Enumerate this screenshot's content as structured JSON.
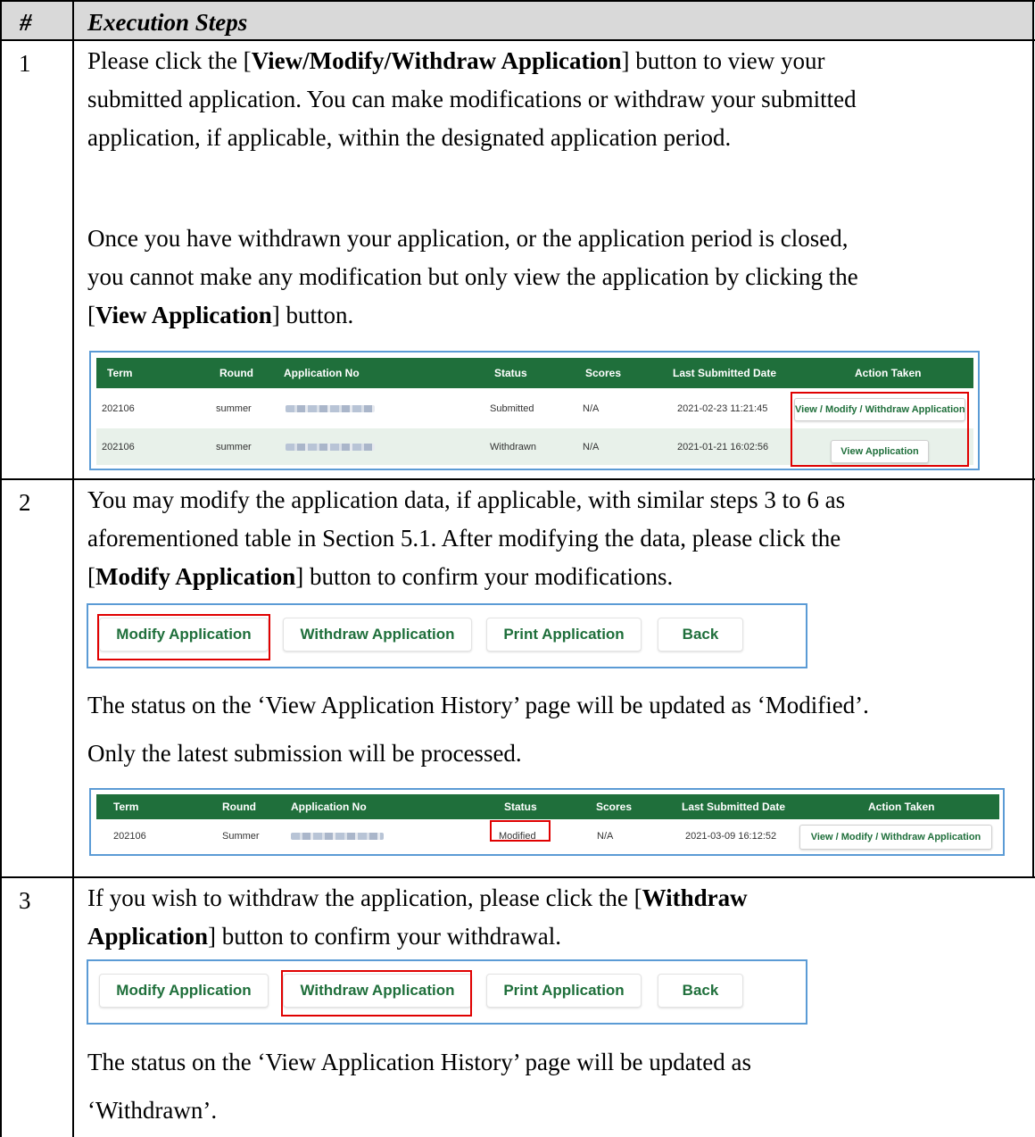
{
  "header": {
    "num_label": "#",
    "steps_label": "Execution Steps"
  },
  "steps": [
    {
      "number": "1",
      "lines": [
        [
          "Please click the [",
          "View/Modify/Withdraw Application",
          "] button to view your"
        ],
        [
          "submitted application.  You can make modifications or withdraw your submitted"
        ],
        [
          "application, if applicable, within the designated application period."
        ],
        [
          "Once you have withdrawn your application, or the application period is closed,"
        ],
        [
          "you cannot make any modification but only view the application by clicking the"
        ],
        [
          "[",
          "View Application",
          "] button."
        ]
      ]
    },
    {
      "number": "2",
      "lines": [
        [
          "You may modify the application data, if applicable, with similar steps 3 to 6 as"
        ],
        [
          "aforementioned table in Section 5.1. After modifying the data, please click the"
        ],
        [
          "[",
          "Modify Application",
          "] button to confirm your modifications."
        ]
      ],
      "after_lines": [
        "The status on the ‘View Application History’ page will be updated as ‘Modified’.",
        "Only the latest submission will be processed."
      ]
    },
    {
      "number": "3",
      "lines": [
        [
          "If you wish to withdraw the application, please click the [",
          "Withdraw",
          ""
        ],
        [
          "",
          "Application",
          "] button to confirm your withdrawal."
        ]
      ],
      "after_lines": [
        "The status on the ‘View Application History’ page will be updated as",
        "‘Withdrawn’."
      ]
    }
  ],
  "history_table": {
    "columns": [
      "Term",
      "Round",
      "Application No",
      "Status",
      "Scores",
      "Last Submitted Date",
      "Action Taken"
    ],
    "rows": [
      {
        "term": "202106",
        "round": "summer",
        "status": "Submitted",
        "scores": "N/A",
        "date": "2021-02-23 11:21:45",
        "action": "View / Modify / Withdraw Application"
      },
      {
        "term": "202106",
        "round": "summer",
        "status": "Withdrawn",
        "scores": "N/A",
        "date": "2021-01-21 16:02:56",
        "action": "View Application"
      }
    ]
  },
  "modified_table": {
    "columns": [
      "Term",
      "Round",
      "Application No",
      "Status",
      "Scores",
      "Last Submitted Date",
      "Action Taken"
    ],
    "rows": [
      {
        "term": "202106",
        "round": "Summer",
        "status": "Modified",
        "scores": "N/A",
        "date": "2021-03-09 16:12:52",
        "action": "View / Modify / Withdraw Application"
      }
    ]
  },
  "action_buttons": [
    "Modify Application",
    "Withdraw Application",
    "Print Application",
    "Back"
  ],
  "colors": {
    "header_green": "#1f6f3b",
    "highlight_red": "#e00000",
    "frame_blue": "#5b9bd5",
    "header_grey": "#d9d9d9"
  }
}
